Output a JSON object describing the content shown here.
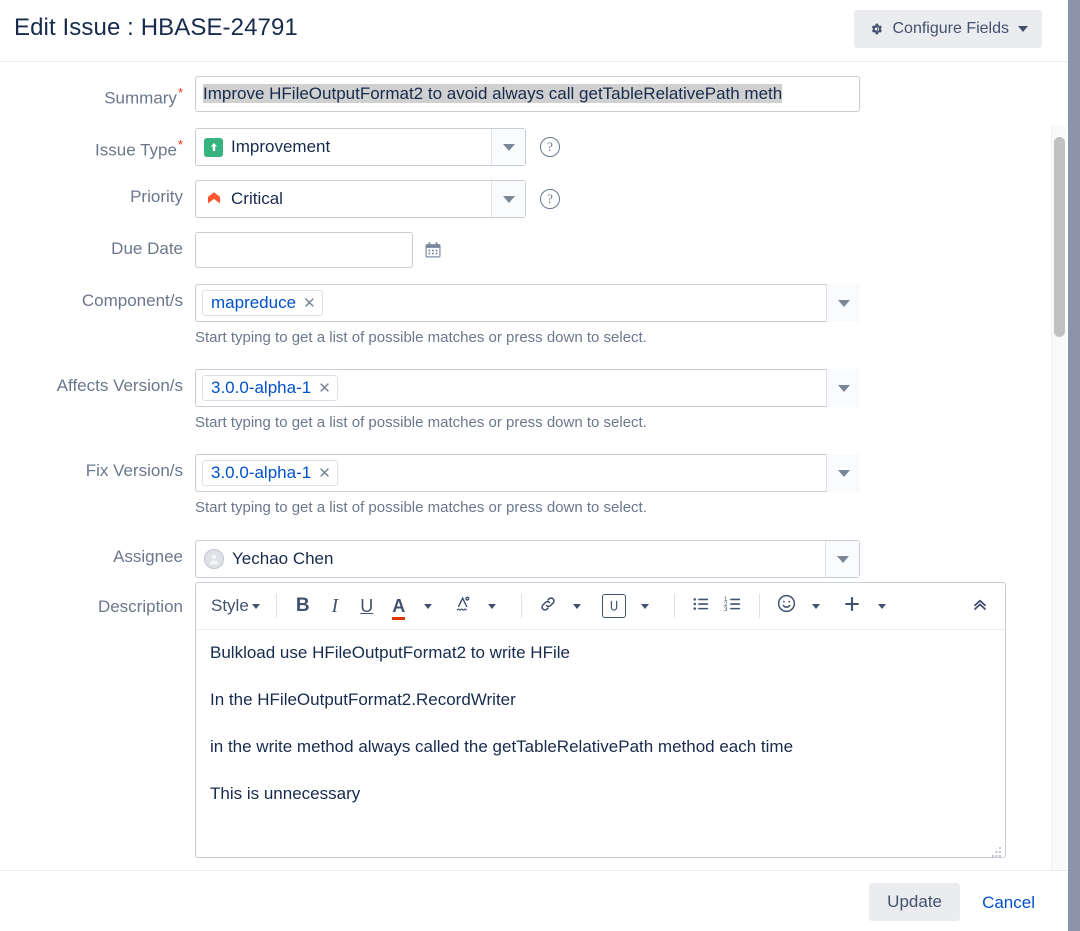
{
  "window": {
    "title": "Edit Issue : HBASE-24791",
    "configure_fields_label": "Configure Fields",
    "gear_icon": "gear-icon",
    "caret_icon": "chevron-down-icon"
  },
  "colors": {
    "accent_link": "#0052cc",
    "required_star": "#de350b",
    "improvement_icon": "#36b37e",
    "critical_icon": "#ff5630",
    "label_text": "#6b778c",
    "body_text": "#172b4d",
    "button_bg": "#ebecf0",
    "backdrop": "#8c94ab"
  },
  "fields": {
    "summary": {
      "label": "Summary",
      "required": true,
      "value": "Improve HFileOutputFormat2 to avoid always call getTableRelativePath meth",
      "selected": true
    },
    "issue_type": {
      "label": "Issue Type",
      "required": true,
      "value": "Improvement",
      "icon": "improvement-arrow-up-icon",
      "has_help": true
    },
    "priority": {
      "label": "Priority",
      "required": false,
      "value": "Critical",
      "icon": "priority-critical-icon",
      "has_help": true
    },
    "due_date": {
      "label": "Due Date",
      "value": "",
      "placeholder": "",
      "icon": "calendar-icon"
    },
    "components": {
      "label": "Component/s",
      "chips": [
        "mapreduce"
      ],
      "hint": "Start typing to get a list of possible matches or press down to select."
    },
    "affects_versions": {
      "label": "Affects Version/s",
      "chips": [
        "3.0.0-alpha-1"
      ],
      "hint": "Start typing to get a list of possible matches or press down to select."
    },
    "fix_versions": {
      "label": "Fix Version/s",
      "chips": [
        "3.0.0-alpha-1"
      ],
      "hint": "Start typing to get a list of possible matches or press down to select."
    },
    "assignee": {
      "label": "Assignee",
      "value": "Yechao Chen",
      "icon": "avatar-icon"
    },
    "description": {
      "label": "Description",
      "paragraphs": [
        "Bulkload use HFileOutputFormat2 to write HFile",
        "In the HFileOutputFormat2.RecordWriter",
        "in the write method always called the getTableRelativePath method each time",
        "This is unnecessary"
      ]
    }
  },
  "editor_toolbar": {
    "style_label": "Style",
    "bold_label": "B",
    "italic_label": "I",
    "underline_label": "U",
    "text_color_label": "A",
    "highlight_label": "A",
    "buttons": [
      {
        "name": "style-dropdown",
        "icon": "text-style-icon"
      },
      {
        "name": "bold-button",
        "icon": "bold-icon"
      },
      {
        "name": "italic-button",
        "icon": "italic-icon"
      },
      {
        "name": "underline-button",
        "icon": "underline-icon"
      },
      {
        "name": "text-color-button",
        "icon": "text-color-icon"
      },
      {
        "name": "highlight-color-button",
        "icon": "highlight-icon"
      },
      {
        "name": "link-button",
        "icon": "link-icon"
      },
      {
        "name": "attachment-button",
        "icon": "paperclip-icon"
      },
      {
        "name": "bullet-list-button",
        "icon": "bullet-list-icon"
      },
      {
        "name": "numbered-list-button",
        "icon": "numbered-list-icon"
      },
      {
        "name": "emoji-button",
        "icon": "emoji-icon"
      },
      {
        "name": "insert-more-button",
        "icon": "plus-icon"
      },
      {
        "name": "collapse-toolbar-button",
        "icon": "chevron-up-double-icon"
      }
    ]
  },
  "footer": {
    "update_label": "Update",
    "cancel_label": "Cancel"
  },
  "scrollbar": {
    "orientation": "vertical",
    "thumb_position": "top"
  }
}
